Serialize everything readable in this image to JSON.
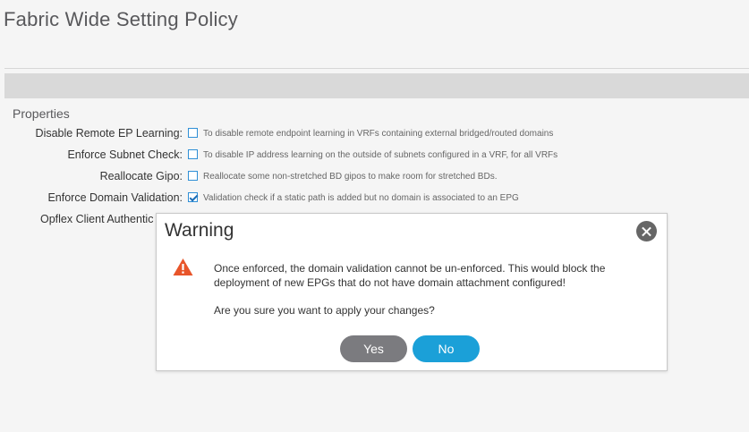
{
  "page": {
    "title": "Fabric Wide Setting Policy",
    "section_title": "Properties"
  },
  "properties": [
    {
      "label": "Disable Remote EP Learning:",
      "checked": false,
      "description": "To disable remote endpoint learning in VRFs containing external bridged/routed domains"
    },
    {
      "label": "Enforce Subnet Check:",
      "checked": false,
      "description": "To disable IP address learning on the outside of subnets configured in a VRF, for all VRFs"
    },
    {
      "label": "Reallocate Gipo:",
      "checked": false,
      "description": "Reallocate some non-stretched BD gipos to make room for stretched BDs."
    },
    {
      "label": "Enforce Domain Validation:",
      "checked": true,
      "description": "Validation check if a static path is added but no domain is associated to an EPG"
    },
    {
      "label": "Opflex Client Authentic",
      "checked": false,
      "description": ""
    }
  ],
  "modal": {
    "title": "Warning",
    "message": "Once enforced, the domain validation cannot be un-enforced. This would block the deployment of new EPGs that do not have domain attachment configured!",
    "question": "Are you sure you want to apply your changes?",
    "yes_label": "Yes",
    "no_label": "No",
    "icons": {
      "warning": "warning-icon",
      "close": "close-icon"
    },
    "colors": {
      "warning": "#e8552a",
      "yes": "#7b7b7f",
      "no": "#1ba0d8"
    }
  }
}
